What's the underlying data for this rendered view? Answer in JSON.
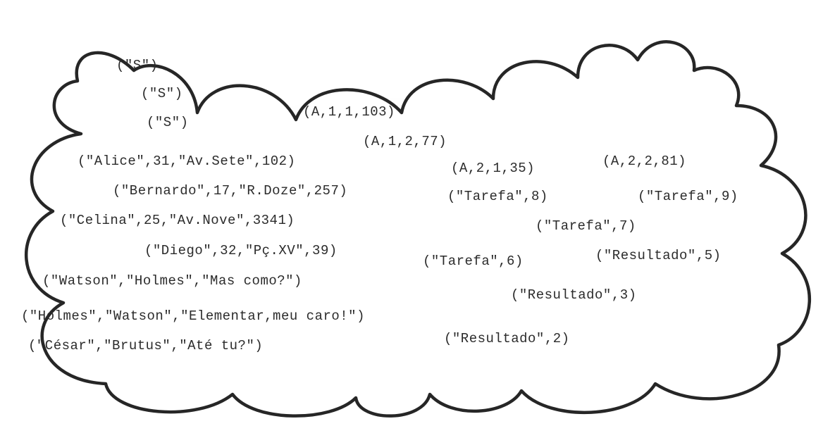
{
  "tuples": {
    "s1": "(\"S\")",
    "s2": "(\"S\")",
    "s3": "(\"S\")",
    "a1": "(A,1,1,103)",
    "a2": "(A,1,2,77)",
    "a3": "(A,2,1,35)",
    "a4": "(A,2,2,81)",
    "p_alice": "(\"Alice\",31,\"Av.Sete\",102)",
    "p_bernardo": "(\"Bernardo\",17,\"R.Doze\",257)",
    "p_celina": "(\"Celina\",25,\"Av.Nove\",3341)",
    "p_diego": "(\"Diego\",32,\"Pç.XV\",39)",
    "d_watson": "(\"Watson\",\"Holmes\",\"Mas como?\")",
    "d_holmes": "(\"Holmes\",\"Watson\",\"Elementar,meu caro!\")",
    "d_cesar": "(\"César\",\"Brutus\",\"Até tu?\")",
    "tar6": "(\"Tarefa\",6)",
    "tar7": "(\"Tarefa\",7)",
    "tar8": "(\"Tarefa\",8)",
    "tar9": "(\"Tarefa\",9)",
    "res2": "(\"Resultado\",2)",
    "res3": "(\"Resultado\",3)",
    "res5": "(\"Resultado\",5)"
  }
}
